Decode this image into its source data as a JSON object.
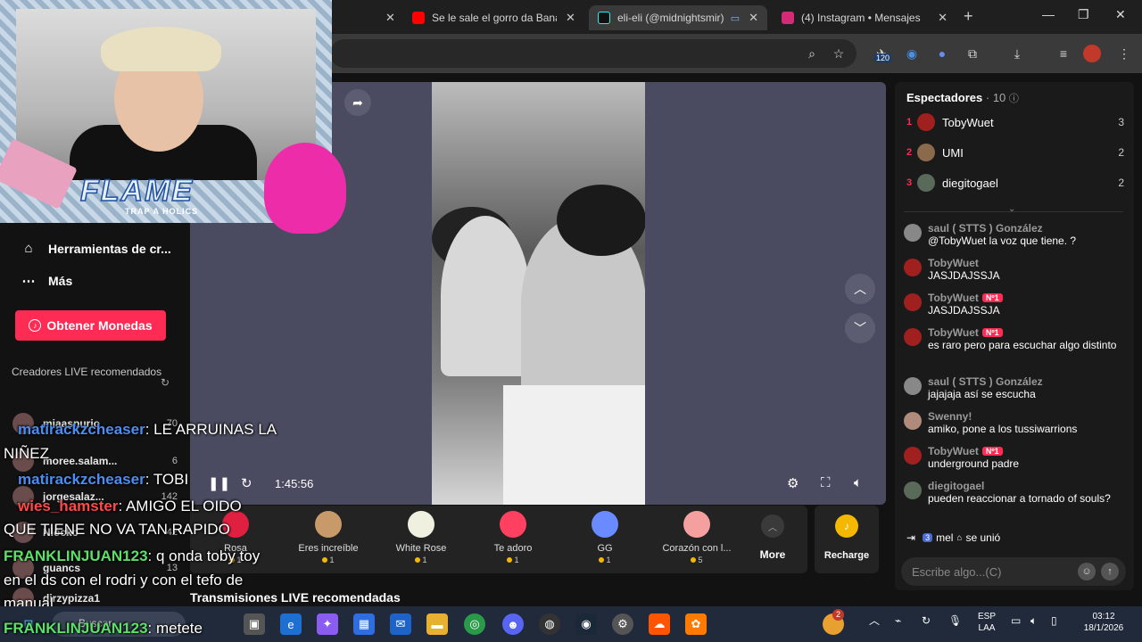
{
  "browser": {
    "tabs": [
      {
        "title": "",
        "active": false,
        "favicon_color": "#888888"
      },
      {
        "title": "Se le sale el gorro da Banan",
        "active": false,
        "favicon_color": "#ff0000"
      },
      {
        "title": "eli-eli (@midnightsmir)",
        "active": true,
        "favicon_color": "#000000"
      },
      {
        "title": "(4) Instagram • Mensajes",
        "active": false,
        "favicon_color": "#d62976"
      }
    ],
    "new_tab": "+",
    "extension_badge": "120"
  },
  "sidebar": {
    "items": [
      {
        "icon": "tools-icon",
        "label": "Herramientas de cr..."
      },
      {
        "icon": "more-dots-icon",
        "label": "Más"
      }
    ],
    "coins_button": "Obtener Monedas",
    "live_header": "Creadores LIVE recomendados",
    "creators": [
      {
        "name": "miaaspurio",
        "count": "70"
      },
      {
        "name": "moree.salam...",
        "count": "6"
      },
      {
        "name": "jorgesalaz...",
        "count": "142"
      },
      {
        "name": "Niocko",
        "count": "42"
      },
      {
        "name": "guancs",
        "count": "13"
      },
      {
        "name": "dirzypizza1",
        "count": ""
      }
    ]
  },
  "player": {
    "timecode": "1:45:56"
  },
  "gifts": [
    {
      "name": "Rosa",
      "price": "1",
      "icon": "rose-icon",
      "color": "#e02040"
    },
    {
      "name": "Eres increíble",
      "price": "1",
      "icon": "cat-icon",
      "color": "#c89a6a"
    },
    {
      "name": "White Rose",
      "price": "1",
      "icon": "white-rose-icon",
      "color": "#f0f0e0"
    },
    {
      "name": "Te adoro",
      "price": "1",
      "icon": "heart-face-icon",
      "color": "#ff4060"
    },
    {
      "name": "GG",
      "price": "1",
      "icon": "gg-icon",
      "color": "#6a8aff"
    },
    {
      "name": "Corazón con l...",
      "price": "5",
      "icon": "heart-hands-icon",
      "color": "#f5a0a0"
    }
  ],
  "gift_more": "More",
  "recharge": "Recharge",
  "recommended_title": "Transmisiones LIVE recomendadas",
  "chat": {
    "viewers_label": "Espectadores",
    "viewers_count": "· 10",
    "top_viewers": [
      {
        "rank": "1",
        "name": "TobyWuet",
        "score": "3",
        "color": "#a02020"
      },
      {
        "rank": "2",
        "name": "UMI",
        "score": "2",
        "color": "#8a6a4a"
      },
      {
        "rank": "3",
        "name": "diegitogael",
        "score": "2",
        "color": "#5a6a5a"
      }
    ],
    "messages": [
      {
        "user": "saul ( STTS ) González",
        "tag": "",
        "text": "@TobyWuet la voz que tiene. ?",
        "color": "#888888"
      },
      {
        "user": "TobyWuet",
        "tag": "",
        "text": "JASJDAJSSJA",
        "color": "#a02020"
      },
      {
        "user": "TobyWuet",
        "tag": "Nº1",
        "text": "JASJDAJSSJA",
        "color": "#a02020"
      },
      {
        "user": "TobyWuet",
        "tag": "Nº1",
        "text": "es raro pero para escuchar algo distinto",
        "color": "#a02020"
      },
      {
        "user": "saul ( STTS ) González",
        "tag": "",
        "text": "jajajaja así se escucha",
        "color": "#888888"
      },
      {
        "user": "Swenny!",
        "tag": "",
        "text": "amiko, pone a los tussiwarrions",
        "color": "#b08a7a"
      },
      {
        "user": "TobyWuet",
        "tag": "Nº1",
        "text": "underground padre",
        "color": "#a02020"
      },
      {
        "user": "diegitogael",
        "tag": "",
        "text": "pueden reaccionar a tornado of souls?",
        "color": "#5a6a5a"
      }
    ],
    "joined_level": "3",
    "joined_user": "mel",
    "joined_text": "se unió",
    "input_placeholder": "Escribe algo...(C)"
  },
  "overlay": {
    "brand": "FLAME",
    "brand_sub": "TRAP A HOLICS",
    "lines": [
      {
        "user": "matirackzcheaser",
        "text": ": LE ARRUINAS LA"
      },
      {
        "user": "",
        "text": "NIÑEZ"
      },
      {
        "user": "matirackzcheaser",
        "text": ": TOBI"
      },
      {
        "user": "wies_hamster",
        "text": ": AMIGO EL OIDO"
      },
      {
        "user": "",
        "text": "QUE TIENE NO VA TAN RAPIDO"
      },
      {
        "user": "FRANKLINJUAN123",
        "text": ": q onda toby toy"
      },
      {
        "user": "",
        "text": "en el ds con el rodri y con el tefo de"
      },
      {
        "user": "",
        "text": "manual"
      },
      {
        "user": "FRANKLINJUAN123",
        "text": ": metete"
      }
    ]
  },
  "taskbar": {
    "search": "Buscar",
    "lang_top": "ESP",
    "lang_bottom": "LAA",
    "time": "03:12",
    "date": "18/1/2026",
    "notif_count": "2"
  }
}
